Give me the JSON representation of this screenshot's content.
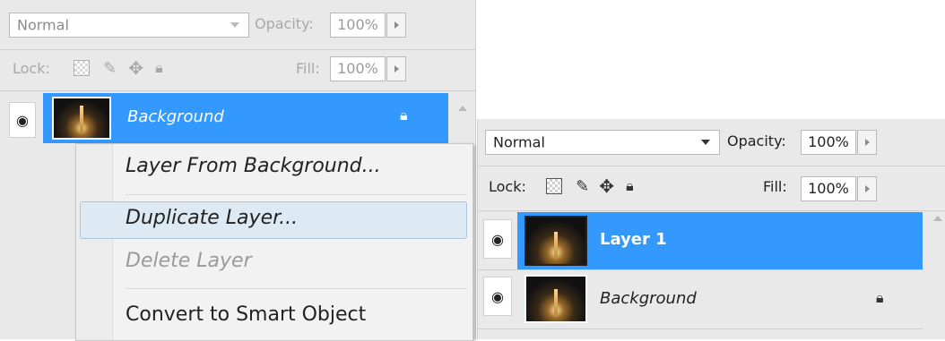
{
  "left_panel": {
    "blend_mode": "Normal",
    "opacity_label": "Opacity:",
    "opacity_value": "100%",
    "lock_label": "Lock:",
    "fill_label": "Fill:",
    "fill_value": "100%",
    "layers": [
      {
        "name": "Background",
        "selected": true,
        "locked": true
      }
    ]
  },
  "context_menu": {
    "items": [
      {
        "label": "Layer From Background...",
        "enabled": true
      },
      {
        "label": "Duplicate Layer...",
        "enabled": true,
        "hovered": true
      },
      {
        "label": "Delete Layer",
        "enabled": false
      },
      {
        "label": "Convert to Smart Object",
        "enabled": true
      }
    ]
  },
  "right_panel": {
    "blend_mode": "Normal",
    "opacity_label": "Opacity:",
    "opacity_value": "100%",
    "lock_label": "Lock:",
    "fill_label": "Fill:",
    "fill_value": "100%",
    "layers": [
      {
        "name": "Layer 1",
        "selected": true,
        "locked": false
      },
      {
        "name": "Background",
        "selected": false,
        "locked": true
      }
    ]
  },
  "colors": {
    "panel_bg": "#e9e9e9",
    "selection_blue": "#3399ff",
    "disabled_text": "#9a9a9a",
    "label_gray": "#a8a8a8"
  },
  "icons": [
    "eye-icon",
    "lock-transparent-icon",
    "lock-image-icon",
    "lock-position-icon",
    "lock-all-icon",
    "padlock-icon",
    "dropdown-arrow-icon",
    "slider-arrow-icon",
    "scroll-up-icon",
    "layer-thumbnail"
  ]
}
